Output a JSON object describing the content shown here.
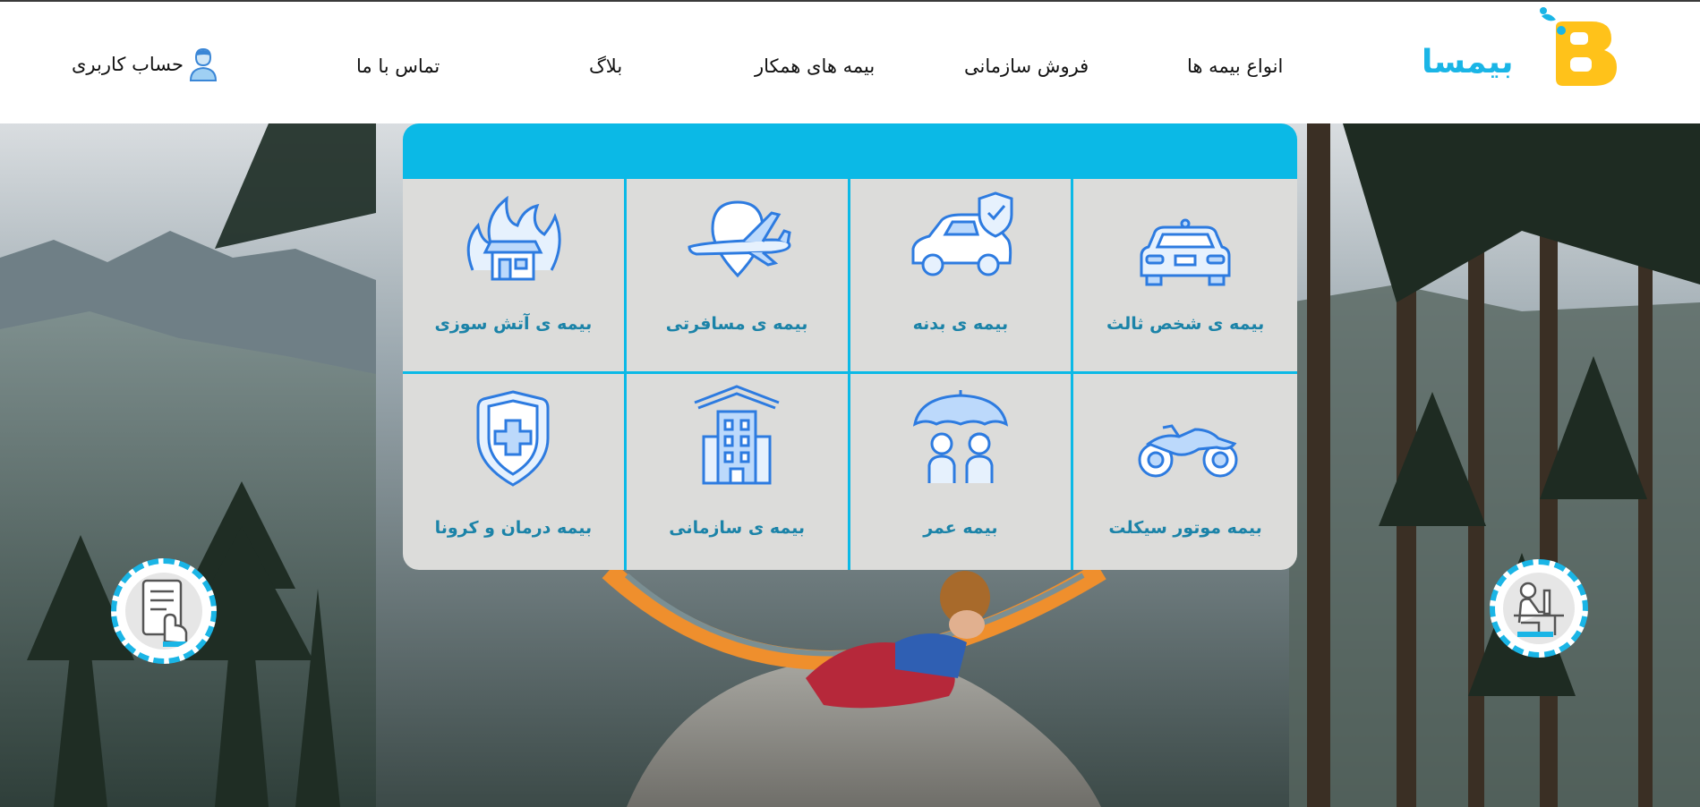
{
  "brand": {
    "name": "بیمسا",
    "letter": "B",
    "primary": "#1ab5e6",
    "accent": "#ffc21a"
  },
  "nav": {
    "items": [
      {
        "label": "انواع بیمه ها"
      },
      {
        "label": "فروش سازمانی"
      },
      {
        "label": "بیمه های همکار"
      },
      {
        "label": "بلاگ"
      },
      {
        "label": "تماس با ما"
      }
    ],
    "account_label": "حساب کاربری"
  },
  "insurance": {
    "header_color": "#0bb9e6",
    "items": [
      {
        "label": "بیمه ی آتش سوزی",
        "icon": "burning-house-icon"
      },
      {
        "label": "بیمه ی مسافرتی",
        "icon": "airplane-icon"
      },
      {
        "label": "بیمه ی بدنه",
        "icon": "car-shield-icon"
      },
      {
        "label": "بیمه ی شخص ثالث",
        "icon": "car-front-icon"
      },
      {
        "label": "بیمه درمان و کرونا",
        "icon": "medical-shield-icon"
      },
      {
        "label": "بیمه ی سازمانی",
        "icon": "office-building-icon"
      },
      {
        "label": "بیمه عمر",
        "icon": "umbrella-family-icon"
      },
      {
        "label": "بیمه موتور سیکلت",
        "icon": "motorcycle-icon"
      }
    ]
  },
  "badges": {
    "left": "tablet-touch-icon",
    "right": "desk-worker-icon"
  }
}
